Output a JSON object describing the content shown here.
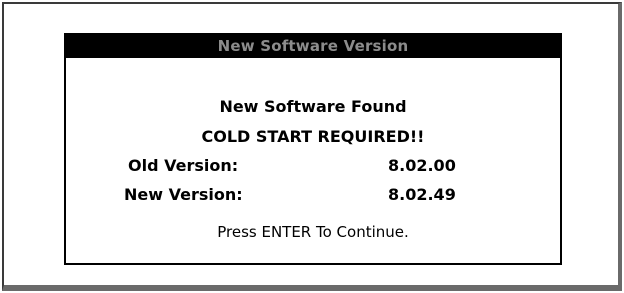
{
  "dialog": {
    "title": "New Software Version",
    "message_found": "New Software Found",
    "message_cold_start": "COLD START REQUIRED!!",
    "old_version_label": "Old Version:",
    "old_version_value": "8.02.00",
    "new_version_label": "New Version:",
    "new_version_value": "8.02.49",
    "prompt": "Press ENTER To Continue."
  },
  "colors": {
    "header_bg": "#000000",
    "header_text": "#8c8c8c",
    "frame_border": "#6a6a6a"
  }
}
